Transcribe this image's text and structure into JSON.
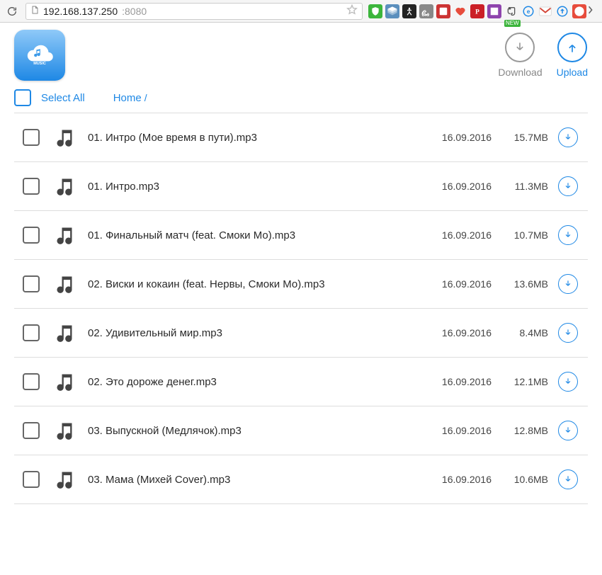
{
  "browser": {
    "url_host": "192.168.137.250",
    "url_port": ":8080",
    "extensions": [
      {
        "name": "adblock",
        "bg": "#3cb53c",
        "glyph": "shield"
      },
      {
        "name": "layers",
        "bg": "#5b8fbd",
        "glyph": "layers"
      },
      {
        "name": "stick",
        "bg": "#222",
        "glyph": "person"
      },
      {
        "name": "spiral",
        "bg": "#888",
        "glyph": "spiral"
      },
      {
        "name": "block",
        "bg": "#c33",
        "glyph": "block"
      },
      {
        "name": "heart",
        "bg": "transparent",
        "glyph": "heart",
        "fg": "#e74c3c"
      },
      {
        "name": "pinterest",
        "bg": "#cb2027",
        "glyph": "p"
      },
      {
        "name": "purple",
        "bg": "#8e44ad",
        "glyph": "square"
      },
      {
        "name": "evernote",
        "bg": "transparent",
        "glyph": "evernote",
        "fg": "#555",
        "badge": "NEW"
      },
      {
        "name": "e-circle",
        "bg": "transparent",
        "glyph": "ecircle",
        "fg": "#1e88e5"
      },
      {
        "name": "gmail",
        "bg": "transparent",
        "glyph": "gmail"
      },
      {
        "name": "sync",
        "bg": "transparent",
        "glyph": "sync",
        "fg": "#1e88e5"
      },
      {
        "name": "red-circle",
        "bg": "#e74c3c",
        "glyph": "circle"
      }
    ]
  },
  "header": {
    "download_label": "Download",
    "upload_label": "Upload"
  },
  "subbar": {
    "select_all": "Select All",
    "home": "Home",
    "sep": "/"
  },
  "files": [
    {
      "name": "01. Интро (Мое время в пути).mp3",
      "date": "16.09.2016",
      "size": "15.7MB"
    },
    {
      "name": "01. Интро.mp3",
      "date": "16.09.2016",
      "size": "11.3MB"
    },
    {
      "name": "01. Финальный матч (feat. Смоки Мо).mp3",
      "date": "16.09.2016",
      "size": "10.7MB"
    },
    {
      "name": "02. Виски и кокаин (feat. Нервы, Смоки Мо).mp3",
      "date": "16.09.2016",
      "size": "13.6MB"
    },
    {
      "name": "02. Удивительный мир.mp3",
      "date": "16.09.2016",
      "size": "8.4MB"
    },
    {
      "name": "02. Это дороже денег.mp3",
      "date": "16.09.2016",
      "size": "12.1MB"
    },
    {
      "name": "03. Выпускной (Медлячок).mp3",
      "date": "16.09.2016",
      "size": "12.8MB"
    },
    {
      "name": "03. Мама (Михей Cover).mp3",
      "date": "16.09.2016",
      "size": "10.6MB"
    }
  ]
}
